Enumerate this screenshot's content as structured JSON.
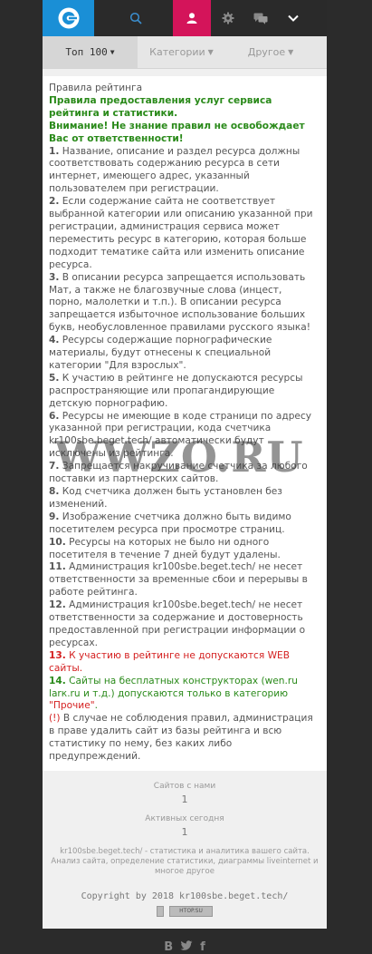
{
  "nav": {
    "tabs": [
      {
        "label": "Топ 100"
      },
      {
        "label": "Категории"
      },
      {
        "label": "Другое"
      }
    ]
  },
  "content": {
    "title": "Правила рейтинга",
    "heading": "Правила предоставления услуг сервиса рейтинга и статистики.",
    "warning": "Внимание! Не знание правил не освобождает Вас от ответственности!",
    "rules": [
      {
        "n": "1.",
        "text": " Название, описание и раздел ресурса должны соответствовать содержанию ресурса в сети интернет, имеющего адрес, указанный пользователем при регистрации."
      },
      {
        "n": "2.",
        "text": " Если содержание сайта не соответствует выбранной категории или описанию указанной при регистрации, администрация сервиса может переместить ресурс в категорию, которая больше подходит тематике сайта или изменить описание ресурса."
      },
      {
        "n": "3.",
        "text": " В описании ресурса запрещается использовать Мат, а также не благозвучные слова (инцест, порно, малолетки и т.п.). В описании ресурса запрещается избыточное использование больших букв, необусловленное правилами русского языка!"
      },
      {
        "n": "4.",
        "text": " Ресурсы содержащие порнографические материалы, будут отнесены к специальной категории \"Для взрослых\"."
      },
      {
        "n": "5.",
        "text": " К участию в рейтинге не допускаются ресурсы распространяющие или пропагандирующие детскую порнографию."
      },
      {
        "n": "6.",
        "text": " Ресурсы не имеющие в коде страници по адресу указанной при регистрации, кода счетчика kr100sbe.beget.tech/ автоматически будут исключены из рейтинга."
      },
      {
        "n": "7.",
        "text": " Запрещается накручивание счетчика за любого поставки из партнерских сайтов."
      },
      {
        "n": "8.",
        "text": " Код счетчика должен быть установлен без изменений."
      },
      {
        "n": "9.",
        "text": " Изображение счетчика должно быть видимо посетителем ресурса при просмотре страниц."
      },
      {
        "n": "10.",
        "text": " Ресурсы на которых не было ни одного посетителя в течение 7 дней будут удалены."
      },
      {
        "n": "11.",
        "text": " Администрация kr100sbe.beget.tech/ не несет ответственности за временные сбои и перерывы в работе рейтинга."
      },
      {
        "n": "12.",
        "text": " Администрация kr100sbe.beget.tech/ не несет ответственности за содержание и достоверность предоставленной при регистрации информации о ресурсах."
      }
    ],
    "rule13_n": "13.",
    "rule13_text": " К участию в рейтинге не допускаются WEB сайты.",
    "rule14_n": "14.",
    "rule14_text": " Сайты на бесплатных конструкторах (wen.ru larк.ru и т.д.) допускаются только в категорию ",
    "rule14_highlight": "\"Прочие\"",
    "rule14_end": ".",
    "rule_last_n": "(!)",
    "rule_last_text": " В случае не соблюдения правил, администрация в праве удалить сайт из базы рейтинга и всю статистику по нему, без каких либо предупреждений."
  },
  "footer": {
    "sites_label": "Сайтов с нами",
    "sites_value": "1",
    "active_label": "Активных сегодня",
    "active_value": "1",
    "description": "kr100sbe.beget.tech/ - статистика и аналитика вашего сайта. Анализ сайта, определение статистики, диаграммы liveinternet и многое другое",
    "copyright": "Copyright by 2018 kr100sbe.beget.tech/",
    "badge": "HTOP.SU",
    "social": [
      "B",
      "f"
    ]
  },
  "watermark": "WWZO.RU",
  "colors": {
    "accent_blue": "#1a8fd6",
    "accent_pink": "#d4145a",
    "green": "#2a8a1a",
    "red": "#d42020"
  }
}
